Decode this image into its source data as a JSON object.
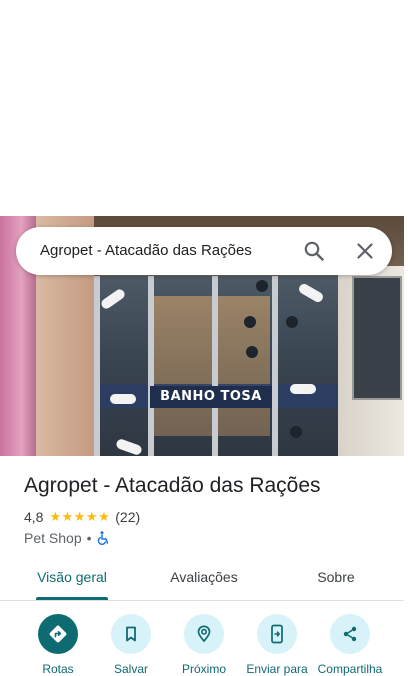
{
  "search": {
    "query": "Agropet - Atacadão das Rações"
  },
  "hero": {
    "sign_text": "BANHO  TOSA"
  },
  "place": {
    "name": "Agropet - Atacadão das Rações",
    "rating": "4,8",
    "stars": 5,
    "stars_text": "★★★★★",
    "review_count": "(22)",
    "category": "Pet Shop",
    "separator": "•"
  },
  "tabs": [
    {
      "label": "Visão geral",
      "active": true
    },
    {
      "label": "Avaliações",
      "active": false
    },
    {
      "label": "Sobre",
      "active": false
    }
  ],
  "actions": [
    {
      "label": "Rotas",
      "icon": "directions-icon"
    },
    {
      "label": "Salvar",
      "icon": "bookmark-icon"
    },
    {
      "label": "Próximo",
      "icon": "nearby-icon"
    },
    {
      "label": "Enviar para",
      "icon": "send-to-phone-icon"
    },
    {
      "label": "Compartilha",
      "icon": "share-icon"
    }
  ],
  "colors": {
    "accent": "#0f6b72",
    "star": "#fbbc04",
    "action_bg": "#d7f2f8",
    "accessibility": "#1a73e8"
  }
}
